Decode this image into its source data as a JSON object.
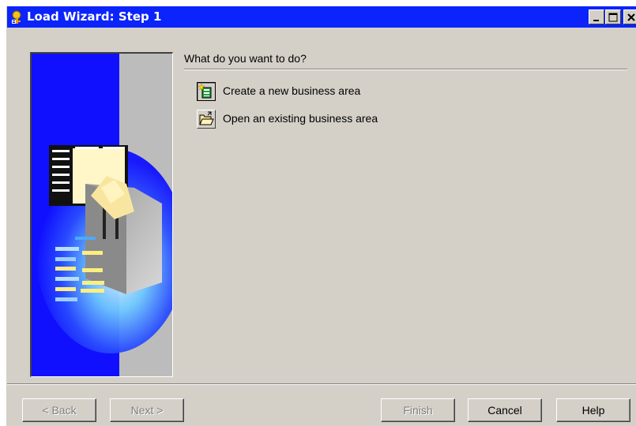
{
  "window": {
    "title": "Load Wizard: Step 1",
    "icon": "wizard-icon"
  },
  "main": {
    "question": "What do you want to do?",
    "options": [
      {
        "label": "Create a new business area",
        "icon": "new-business-area-icon"
      },
      {
        "label": "Open an existing business area",
        "icon": "open-folder-icon"
      }
    ]
  },
  "buttons": {
    "back": "< Back",
    "next": "Next >",
    "finish": "Finish",
    "cancel": "Cancel",
    "help": "Help"
  },
  "colors": {
    "titlebar": "#0b24fb",
    "face": "#d4d0c8",
    "art_blue": "#1a1aff"
  }
}
